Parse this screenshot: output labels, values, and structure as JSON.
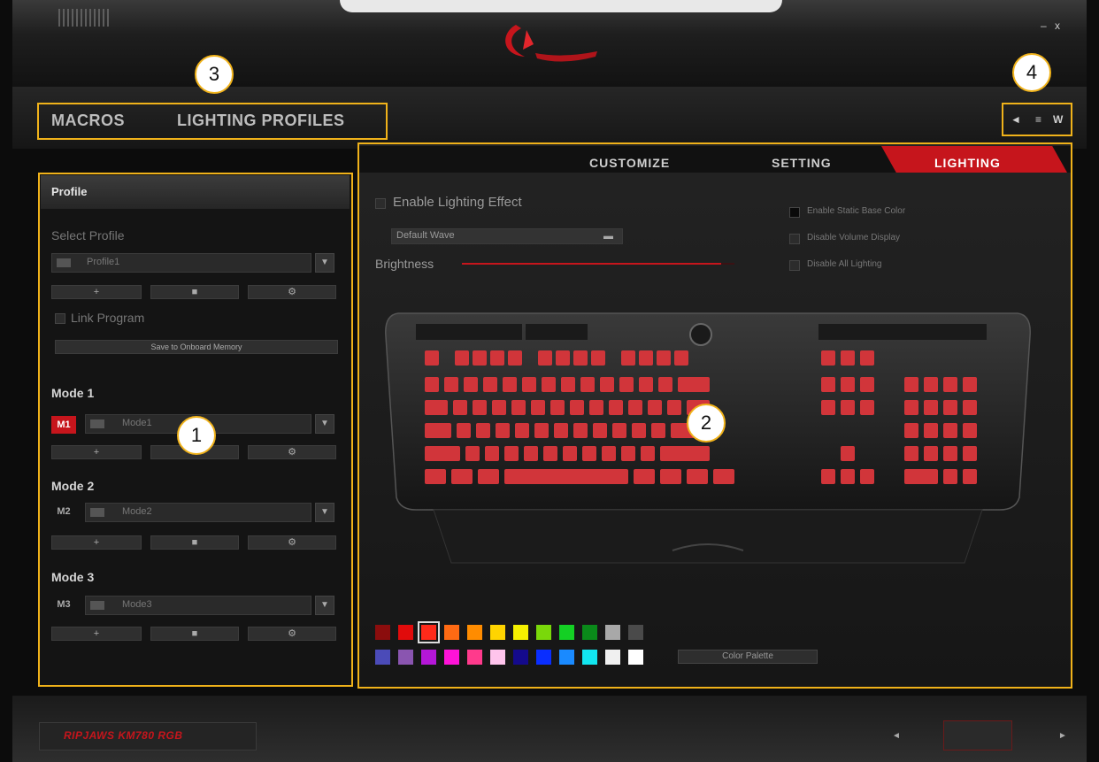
{
  "window": {
    "minimize_label": "–",
    "close_label": "x"
  },
  "nav": {
    "macros": "MACROS",
    "lighting_profiles": "LIGHTING PROFILES",
    "icons": [
      "◄",
      "≡",
      "W"
    ]
  },
  "callouts": [
    "1",
    "2",
    "3",
    "4"
  ],
  "left_panel": {
    "title": "Profile",
    "select_profile_label": "Select Profile",
    "profile_value": "Profile1",
    "profile_buttons": [
      "+",
      "■",
      "⚙"
    ],
    "link_program_label": "Link Program",
    "save_button": "Save to Onboard Memory",
    "modes": [
      {
        "title": "Mode 1",
        "badge": "M1",
        "value": "Mode1",
        "active": true
      },
      {
        "title": "Mode 2",
        "badge": "M2",
        "value": "Mode2",
        "active": false
      },
      {
        "title": "Mode 3",
        "badge": "M3",
        "value": "Mode3",
        "active": false
      }
    ],
    "mode_buttons": [
      "+",
      "■",
      "⚙"
    ]
  },
  "tabs": {
    "customize": "CUSTOMIZE",
    "setting": "SETTING",
    "lighting": "LIGHTING"
  },
  "lighting": {
    "enable_effect_label": "Enable Lighting Effect",
    "effect_value": "Default Wave",
    "brightness_label": "Brightness",
    "brightness_level": 0.95,
    "options": [
      {
        "label": "Enable Static Base Color",
        "checked": true
      },
      {
        "label": "Disable Volume Display",
        "checked": false
      },
      {
        "label": "Disable All Lighting",
        "checked": false
      }
    ]
  },
  "palette": {
    "row1": [
      "#8b0d0d",
      "#e10b0b",
      "#ff2a1a",
      "#ff6a13",
      "#ff8c00",
      "#ffd400",
      "#f5f000",
      "#7ad80a",
      "#14d024",
      "#0a8a1a",
      "#a8a8a8",
      "#4a4a4a"
    ],
    "row2": [
      "#4b4bb8",
      "#8a55b0",
      "#b517d8",
      "#ff13d8",
      "#ff3a8c",
      "#ffc4ec",
      "#140a8c",
      "#0a2eff",
      "#1a8aff",
      "#12e6f0",
      "#f0f0f0",
      "#ffffff"
    ],
    "selected_index": 2,
    "button_label": "Color Palette"
  },
  "footer": {
    "device_name": "RIPJAWS KM780 RGB",
    "prev": "◄",
    "next": "►"
  },
  "colors": {
    "accent": "#c6151c",
    "callout": "#f0b21a",
    "keycap": "#d1353a"
  }
}
